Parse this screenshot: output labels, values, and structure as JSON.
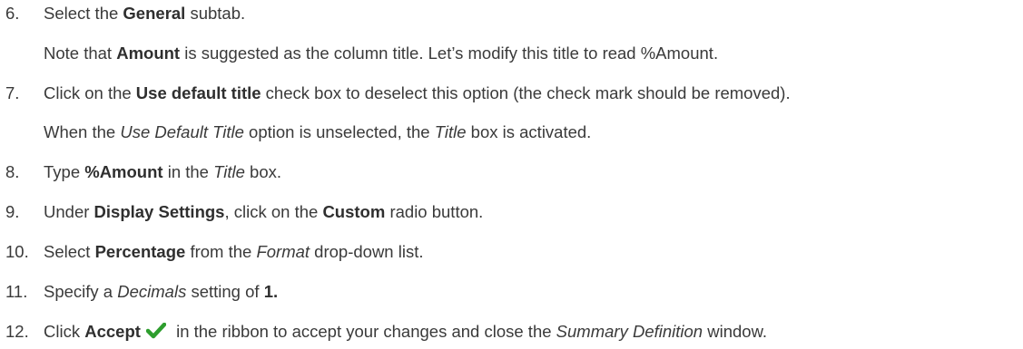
{
  "steps": [
    {
      "number": "6.",
      "parts": [
        "Select the ",
        "General",
        " subtab."
      ],
      "note": [
        "Note that ",
        "Amount",
        " is suggested as the column title. Let’s modify this title to read %Amount."
      ]
    },
    {
      "number": "7.",
      "parts": [
        "Click on the ",
        "Use default title",
        " check box to deselect this option (the check mark should be removed)."
      ],
      "note": [
        "When the ",
        "Use Default Title",
        " option is unselected, the ",
        "Title",
        " box is activated."
      ]
    },
    {
      "number": "8.",
      "parts": [
        "Type ",
        "%Amount",
        " in the ",
        "Title",
        " box."
      ]
    },
    {
      "number": "9.",
      "parts": [
        "Under ",
        "Display Settings",
        ", click on the ",
        "Custom",
        " radio button."
      ]
    },
    {
      "number": "10.",
      "parts": [
        "Select ",
        "Percentage",
        " from the ",
        "Format",
        " drop-down list."
      ]
    },
    {
      "number": "11.",
      "parts": [
        "Specify a ",
        "Decimals",
        " setting of ",
        "1."
      ]
    },
    {
      "number": "12.",
      "parts": [
        "Click ",
        "Accept",
        " in the ribbon to accept your changes and close the ",
        "Summary Definition",
        " window."
      ],
      "icon": "checkmark-icon",
      "icon_color": "#2e9e2e"
    }
  ]
}
